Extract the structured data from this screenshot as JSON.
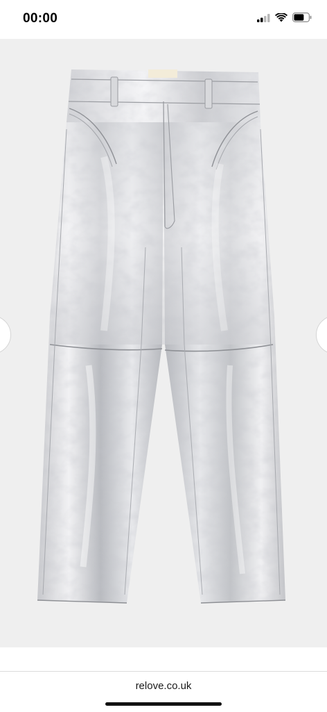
{
  "status_bar": {
    "time": "00:00",
    "icons": [
      "cellular-signal-icon",
      "wifi-icon",
      "battery-icon"
    ]
  },
  "product_image": {
    "subject": "silver-metallic-trousers",
    "label_text": "",
    "colors": {
      "background": "#efefef",
      "fabric_light": "#f4f4f6",
      "fabric_mid": "#d2d3d7",
      "fabric_dark": "#a9abb1"
    }
  },
  "gallery": {
    "prev_icon": "chevron-left-icon",
    "next_icon": "chevron-right-icon"
  },
  "below_image": {
    "text": ""
  },
  "url_bar": {
    "url": "relove.co.uk"
  }
}
